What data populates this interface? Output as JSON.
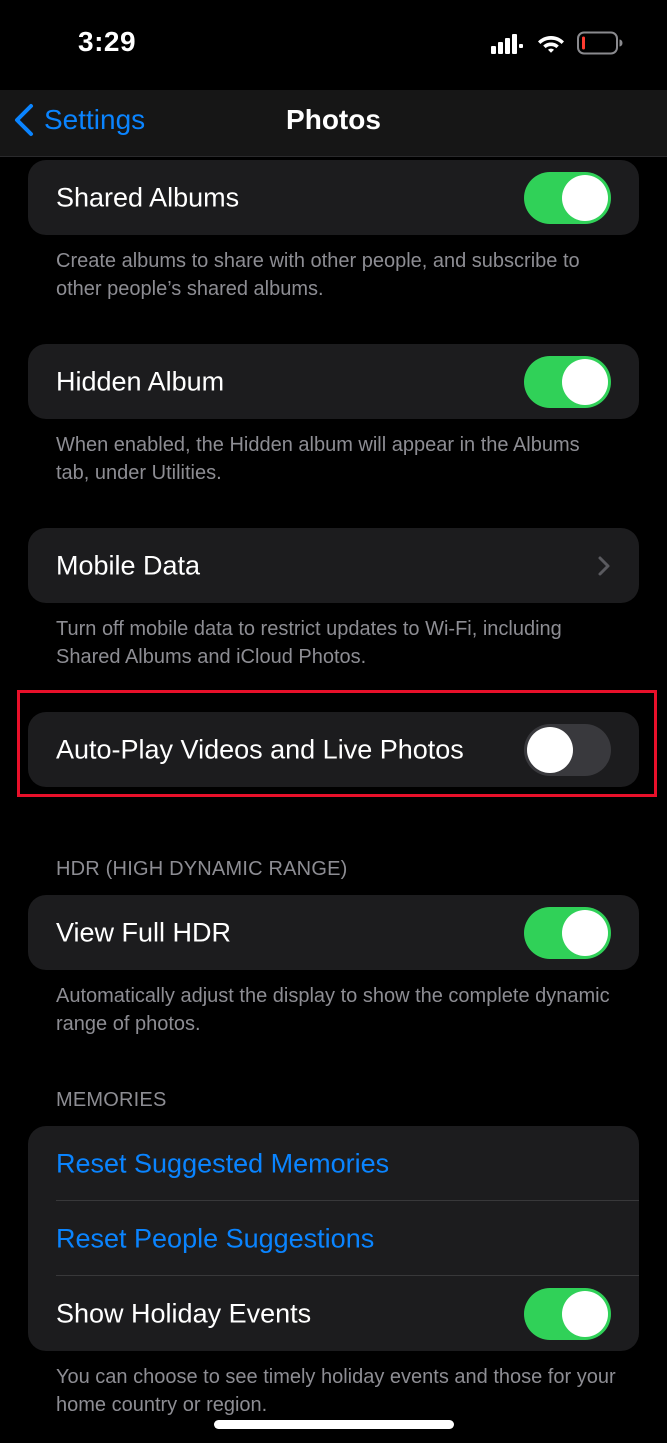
{
  "status_bar": {
    "time": "3:29",
    "icons": [
      "cellular-signal-icon",
      "wifi-icon",
      "battery-low-icon"
    ]
  },
  "nav": {
    "back_label": "Settings",
    "title": "Photos"
  },
  "shared_albums": {
    "label": "Shared Albums",
    "enabled": true,
    "footer": "Create albums to share with other people, and subscribe to other people’s shared albums."
  },
  "hidden_album": {
    "label": "Hidden Album",
    "enabled": true,
    "footer": "When enabled, the Hidden album will appear in the Albums tab, under Utilities."
  },
  "mobile_data": {
    "label": "Mobile Data",
    "footer": "Turn off mobile data to restrict updates to Wi-Fi, including Shared Albums and iCloud Photos."
  },
  "auto_play": {
    "label": "Auto-Play Videos and Live Photos",
    "enabled": false
  },
  "hdr": {
    "header": "HDR (HIGH DYNAMIC RANGE)",
    "label": "View Full HDR",
    "enabled": true,
    "footer": "Automatically adjust the display to show the complete dynamic range of photos."
  },
  "memories": {
    "header": "MEMORIES",
    "reset_suggested": "Reset Suggested Memories",
    "reset_people": "Reset People Suggestions",
    "holiday_label": "Show Holiday Events",
    "holiday_enabled": true,
    "footer": "You can choose to see timely holiday events and those for your home country or region."
  },
  "colors": {
    "background": "#000000",
    "card": "#1c1c1e",
    "accent": "#0a84ff",
    "toggle_on": "#30d158",
    "toggle_off": "#39393d",
    "highlight": "#e8102a",
    "secondary_text": "#8d8d93"
  }
}
